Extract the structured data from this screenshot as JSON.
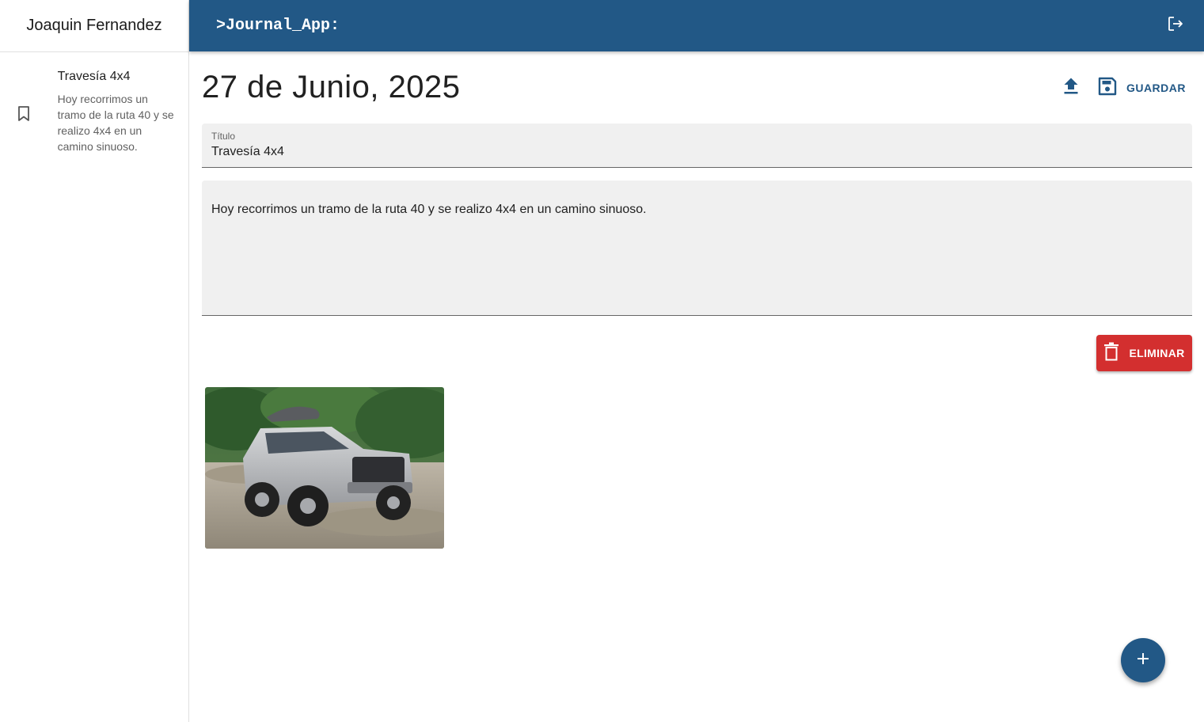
{
  "sidebar": {
    "user_name": "Joaquin Fernandez",
    "entries": [
      {
        "title": "Travesía 4x4",
        "body": "Hoy recorrimos un tramo de la ruta 40 y se realizo 4x4 en un camino sinuoso.",
        "icon": "bookmark-icon"
      }
    ]
  },
  "appbar": {
    "title": ">Journal_App:",
    "logout_icon": "logout-icon",
    "color": "#225886"
  },
  "note": {
    "date": "27 de Junio, 2025",
    "upload_icon": "upload-icon",
    "save_icon": "save-icon",
    "save_label": "GUARDAR",
    "title_label": "Título",
    "title_value": "Travesía 4x4",
    "body_value": "Hoy recorrimos un tramo de la ruta 40 y se realizo 4x4 en un camino sinuoso.",
    "delete_label": "ELIMINAR",
    "delete_icon": "trash-icon",
    "delete_color": "#d32f2f",
    "images": [
      {
        "alt": "Silver 4x4 SUV on gravel terrain",
        "kind": "photo"
      }
    ]
  },
  "fab": {
    "icon": "plus-icon"
  }
}
